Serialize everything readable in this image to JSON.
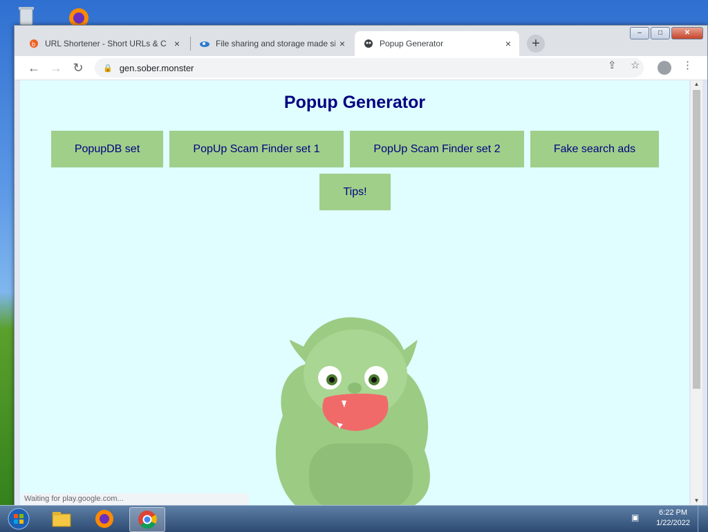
{
  "colors": {
    "page_bg": "#e0fdff",
    "button_bg": "#a0cf8a",
    "title": "#000080",
    "monster_body": "#9ccb84",
    "monster_mouth": "#f06a6a"
  },
  "browser": {
    "tabs": [
      {
        "title": "URL Shortener - Short URLs & C",
        "icon": "bitly-icon",
        "active": false
      },
      {
        "title": "File sharing and storage made si",
        "icon": "cloud-icon",
        "active": false
      },
      {
        "title": "Popup Generator",
        "icon": "monster-favicon-icon",
        "active": true
      }
    ],
    "tab_close": "×",
    "new_tab": "+",
    "address": "gen.sober.monster",
    "window_buttons": {
      "minimize": "–",
      "maximize": "□",
      "close": "✕"
    }
  },
  "page": {
    "title": "Popup Generator",
    "buttons": [
      "PopupDB set",
      "PopUp Scam Finder set 1",
      "PopUp Scam Finder set 2",
      "Fake search ads",
      "Tips!"
    ],
    "status_text": "Waiting for play.google.com..."
  },
  "taskbar": {
    "items": [
      "windows-start-icon",
      "file-explorer-icon",
      "firefox-icon",
      "chrome-icon"
    ],
    "time": "6:22 PM",
    "date": "1/22/2022"
  }
}
